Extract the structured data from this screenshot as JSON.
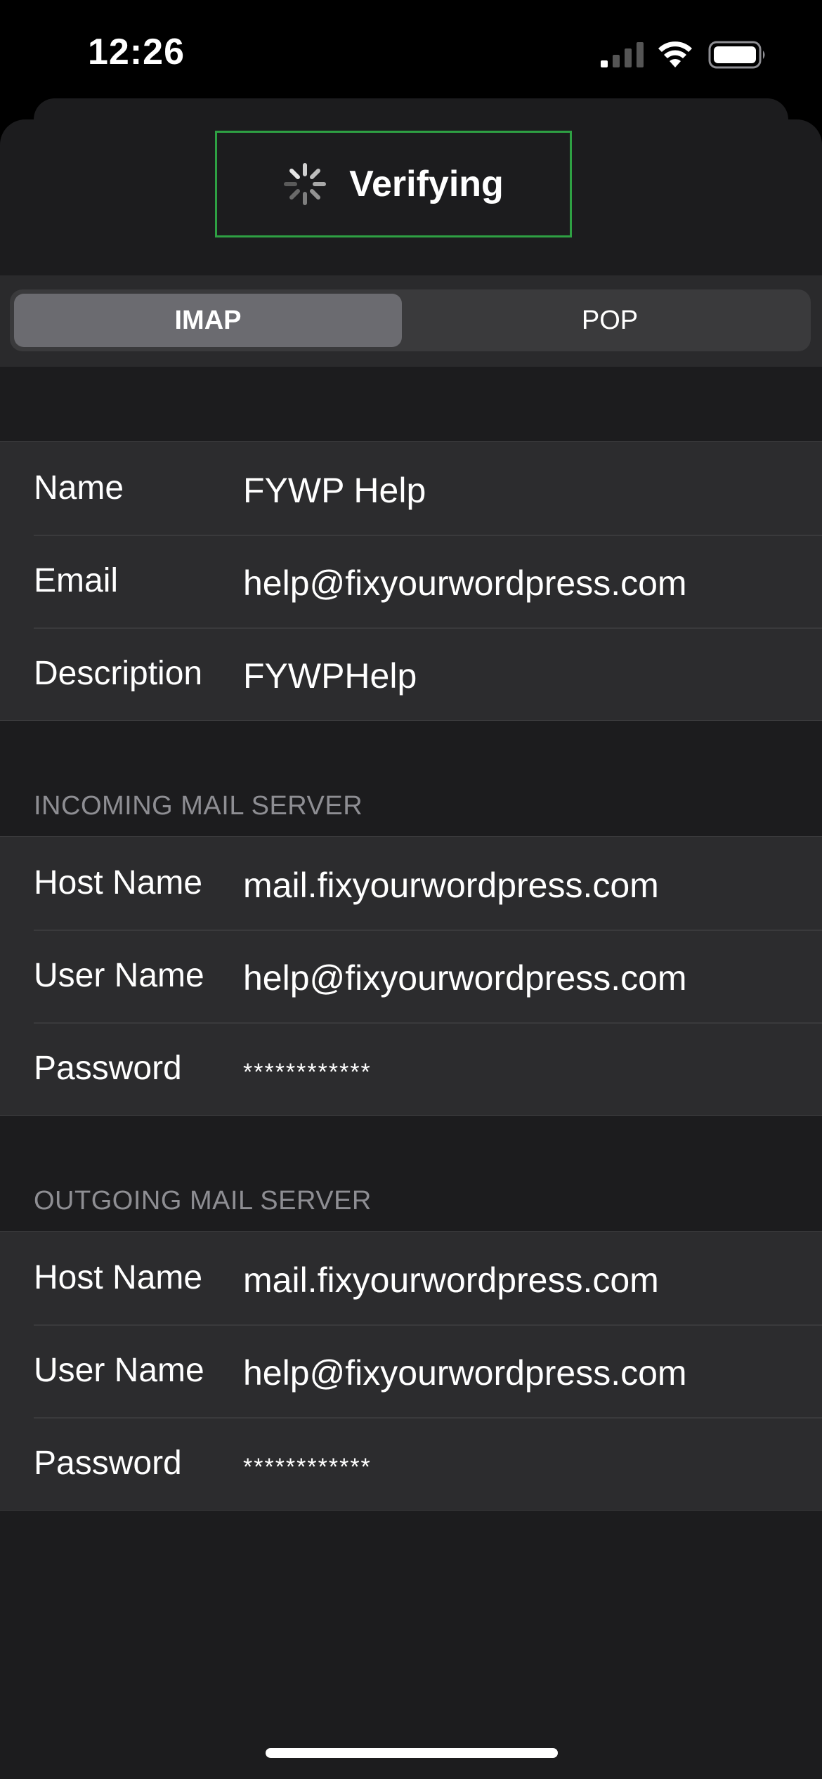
{
  "status_bar": {
    "time": "12:26"
  },
  "header": {
    "title": "Verifying"
  },
  "segmented": {
    "imap": "IMAP",
    "pop": "POP"
  },
  "account": {
    "rows": [
      {
        "label": "Name",
        "value": "FYWP Help"
      },
      {
        "label": "Email",
        "value": "help@fixyourwordpress.com"
      },
      {
        "label": "Description",
        "value": "FYWPHelp"
      }
    ]
  },
  "incoming": {
    "header": "INCOMING MAIL SERVER",
    "rows": [
      {
        "label": "Host Name",
        "value": "mail.fixyourwordpress.com"
      },
      {
        "label": "User Name",
        "value": "help@fixyourwordpress.com"
      },
      {
        "label": "Password",
        "value": "************"
      }
    ]
  },
  "outgoing": {
    "header": "OUTGOING MAIL SERVER",
    "rows": [
      {
        "label": "Host Name",
        "value": "mail.fixyourwordpress.com"
      },
      {
        "label": "User Name",
        "value": "help@fixyourwordpress.com"
      },
      {
        "label": "Password",
        "value": "************"
      }
    ]
  },
  "colors": {
    "highlight": "#2ea043",
    "background": "#1c1c1e",
    "cell": "#2c2c2e",
    "secondary_text": "#8e8e93"
  },
  "icons": {
    "signal": "cellular-signal-icon",
    "wifi": "wifi-icon",
    "battery": "battery-icon",
    "spinner": "activity-spinner-icon"
  }
}
